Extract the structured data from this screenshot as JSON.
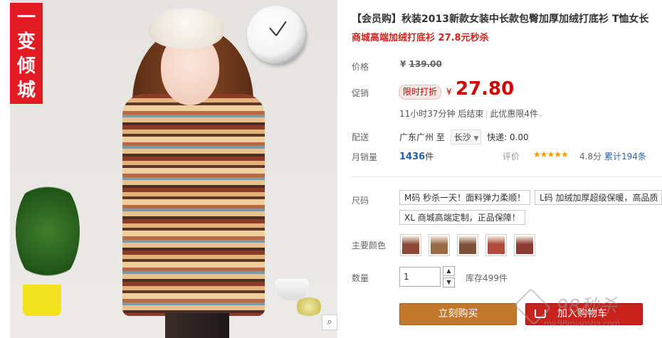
{
  "image": {
    "brand_banner_chars": [
      "一",
      "变",
      "倾",
      "城"
    ]
  },
  "product": {
    "title": "【会员购】秋装2013新款女装中长款包臀加厚加绒打底衫 T恤女长",
    "subtitle": "商城高端加绒打底衫 27.8元秒杀"
  },
  "price": {
    "label": "价格",
    "currency": "¥",
    "original": "139.00"
  },
  "promo": {
    "label": "促销",
    "badge": "限时打折",
    "currency": "¥",
    "price": "27.80",
    "countdown": "11小时37分钟 后结束",
    "limit": "此优惠限4件"
  },
  "shipping": {
    "label": "配送",
    "from": "广东广州",
    "to_word": "至",
    "destination": "长沙",
    "express": "快递: 0.00"
  },
  "sales": {
    "label": "月销量",
    "count": "1436",
    "unit": "件",
    "rating_label": "评价",
    "stars": "★★★★★",
    "score": "4.8分",
    "reviews": "累计194条"
  },
  "options": {
    "size_label": "尺码",
    "sizes": [
      "M码 秒杀一天！面料弹力柔顺！",
      "L码 加绒加厚超级保暖，高品质",
      "XL 商城高端定制，正品保障！"
    ],
    "color_label": "主要颜色",
    "colors": [
      "#8c4a36",
      "#9a6a44",
      "#7d5238",
      "#b04a3a",
      "#8d3a30"
    ]
  },
  "quantity": {
    "label": "数量",
    "value": "1",
    "stock": "库存499件"
  },
  "actions": {
    "buy_now": "立刻购买",
    "add_cart": "加入购物车"
  },
  "watermark": {
    "text": "98秒杀",
    "url": "my.98miaosha.com"
  },
  "colors": {
    "accent_red": "#d10000",
    "buy_button": "#c1782b",
    "cart_button": "#c9211c",
    "link_blue": "#2d63b0"
  }
}
